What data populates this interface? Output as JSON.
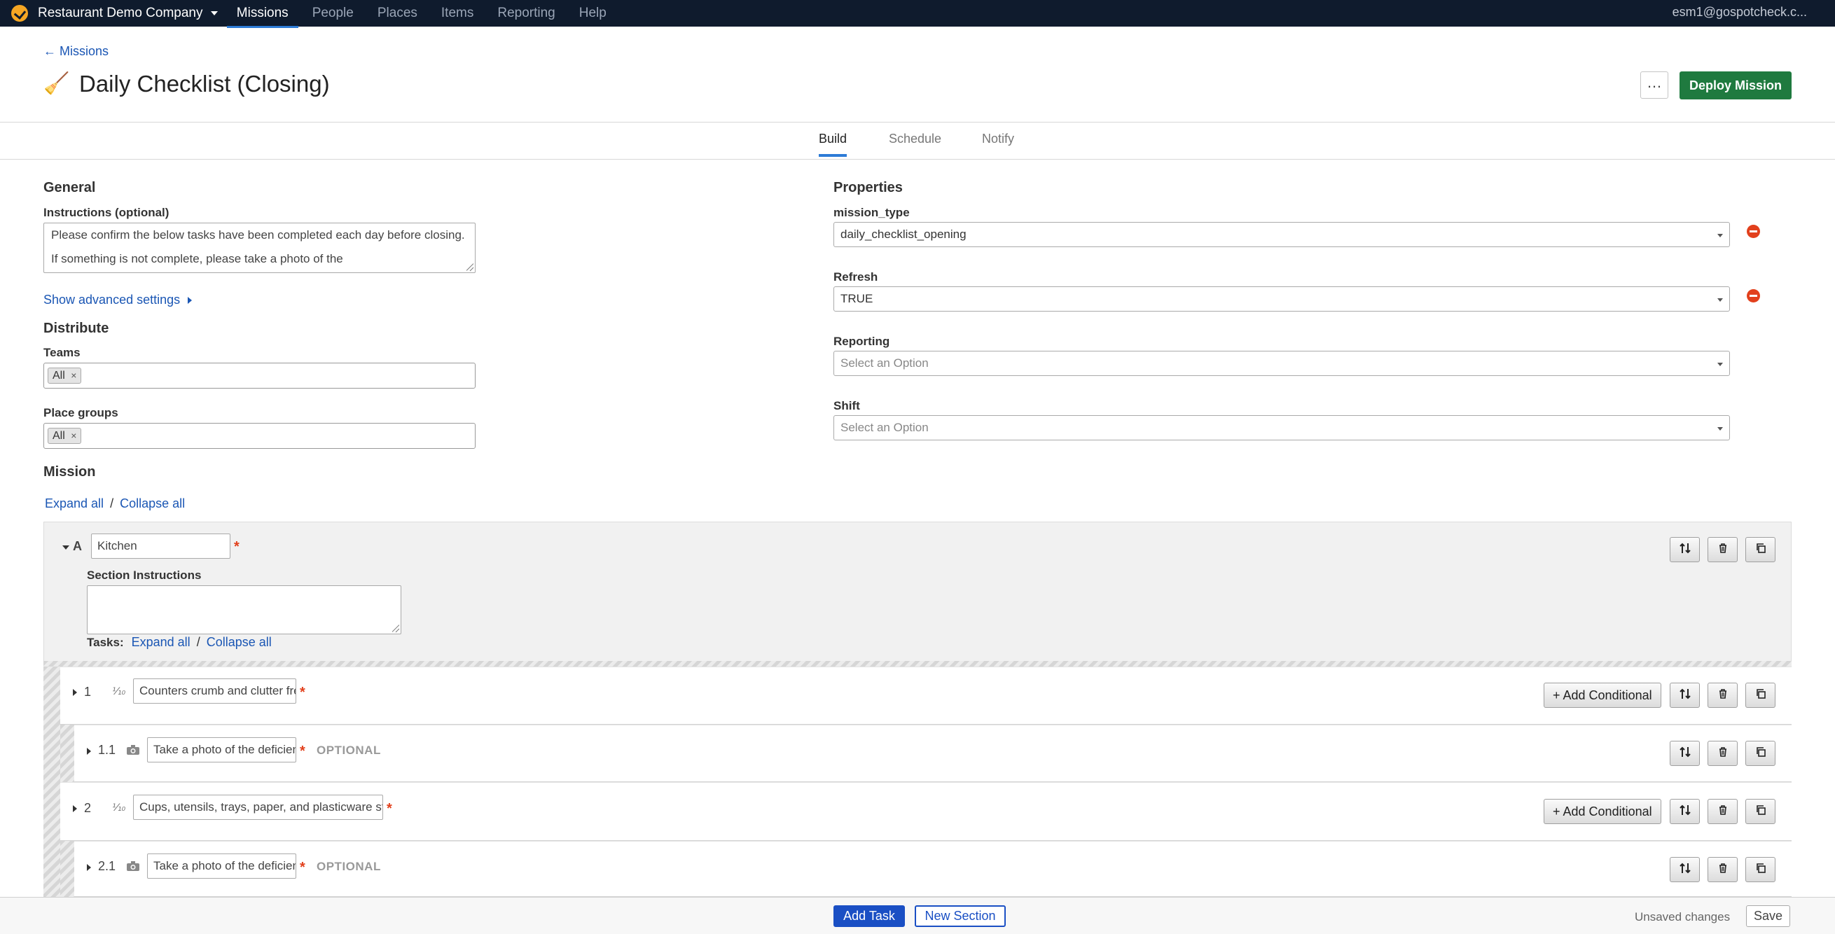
{
  "nav": {
    "company": "Restaurant Demo Company",
    "links": [
      "Missions",
      "People",
      "Places",
      "Items",
      "Reporting",
      "Help"
    ],
    "active": "Missions",
    "user": "esm1@gospotcheck.c..."
  },
  "header": {
    "back_label": "← Missions",
    "title_icon": "🧹",
    "title": "Daily Checklist (Closing)",
    "more_label": "…",
    "deploy_label": "Deploy Mission"
  },
  "tabs": [
    "Build",
    "Schedule",
    "Notify"
  ],
  "general": {
    "heading": "General",
    "instructions_label": "Instructions (optional)",
    "instructions_value": "Please confirm the below tasks have been completed each day before closing.  If something is not complete, please take a photo of the",
    "advanced_label": "Show advanced settings",
    "distribute_heading": "Distribute",
    "teams_label": "Teams",
    "teams_chip": "All",
    "place_groups_label": "Place groups",
    "place_groups_chip": "All",
    "chip_remove": "×"
  },
  "properties": {
    "heading": "Properties",
    "fields": [
      {
        "label": "mission_type",
        "value": "daily_checklist_opening"
      },
      {
        "label": "Refresh",
        "value": "TRUE"
      },
      {
        "label": "Reporting",
        "placeholder": "Select an Option"
      },
      {
        "label": "Shift",
        "placeholder": "Select an Option"
      }
    ]
  },
  "mission": {
    "heading": "Mission",
    "expand_all": "Expand all",
    "separator": "/",
    "collapse_all": "Collapse all",
    "section": {
      "letter": "A",
      "name": "Kitchen",
      "instructions_label": "Section Instructions",
      "tasks_label": "Tasks:"
    },
    "tasks": [
      {
        "num": "1",
        "type_icon": "⅒",
        "text": "Counters crumb and clutter free",
        "optional": ""
      },
      {
        "num": "1.1",
        "type_icon": "camera",
        "text": "Take a photo of the deficiency",
        "optional": "OPTIONAL"
      },
      {
        "num": "2",
        "type_icon": "⅒",
        "text": "Cups, utensils, trays, paper, and plasticware stocked",
        "optional": ""
      },
      {
        "num": "2.1",
        "type_icon": "camera",
        "text": "Take a photo of the deficiency",
        "optional": "OPTIONAL"
      }
    ],
    "add_conditional": "+ Add Conditional",
    "required_mark": "*"
  },
  "footer": {
    "add_task": "Add Task",
    "new_section": "New Section",
    "status": "Unsaved changes",
    "save": "Save"
  },
  "colors": {
    "nav_bg": "#0f1b2d",
    "accent": "#2d7bd6",
    "deploy": "#1f7a3f",
    "link": "#1a56b4",
    "danger": "#e2401c",
    "primary_button": "#1a4fc4"
  }
}
